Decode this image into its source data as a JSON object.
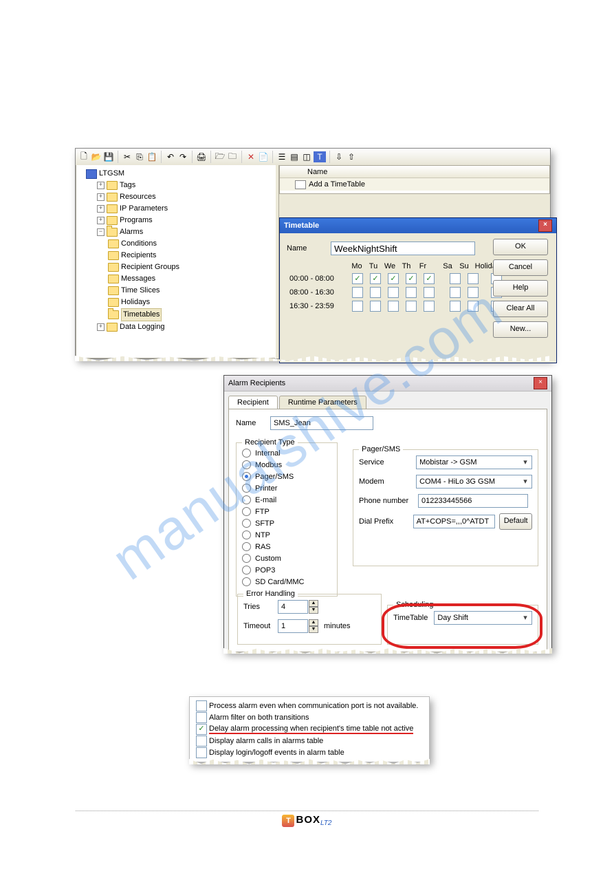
{
  "watermark": "manualshive.com",
  "tree": {
    "root": "LTGSM",
    "items": [
      "Tags",
      "Resources",
      "IP Parameters",
      "Programs",
      "Alarms",
      "Data Logging"
    ],
    "alarms": [
      "Conditions",
      "Recipients",
      "Recipient Groups",
      "Messages",
      "Time Slices",
      "Holidays",
      "Timetables"
    ]
  },
  "list": {
    "header": "Name",
    "add": "Add a TimeTable"
  },
  "timetable": {
    "title": "Timetable",
    "name_label": "Name",
    "name_value": "WeekNightShift",
    "days": [
      "Mo",
      "Tu",
      "We",
      "Th",
      "Fr",
      "Sa",
      "Su",
      "Holiday"
    ],
    "slots": [
      "00:00 - 08:00",
      "08:00 - 16:30",
      "16:30 - 23:59"
    ],
    "grid": [
      [
        true,
        true,
        true,
        true,
        true,
        false,
        false,
        false
      ],
      [
        false,
        false,
        false,
        false,
        false,
        false,
        false,
        false
      ],
      [
        false,
        false,
        false,
        false,
        false,
        false,
        false,
        false
      ]
    ],
    "buttons": [
      "OK",
      "Cancel",
      "Help",
      "Clear All",
      "New..."
    ]
  },
  "recipients": {
    "title": "Alarm Recipients",
    "tabs": [
      "Recipient",
      "Runtime Parameters"
    ],
    "name_label": "Name",
    "name_value": "SMS_Jean",
    "type_legend": "Recipient Type",
    "types": [
      "Internal",
      "Modbus",
      "Pager/SMS",
      "Printer",
      "E-mail",
      "FTP",
      "SFTP",
      "NTP",
      "RAS",
      "Custom",
      "POP3",
      "SD Card/MMC"
    ],
    "type_selected": "Pager/SMS",
    "pager_legend": "Pager/SMS",
    "pager": {
      "service_label": "Service",
      "service_value": "Mobistar -> GSM",
      "modem_label": "Modem",
      "modem_value": "COM4 - HiLo 3G GSM",
      "phone_label": "Phone number",
      "phone_value": "012233445566",
      "dial_label": "Dial Prefix",
      "dial_value": "AT+COPS=,,,0^ATDT",
      "default_btn": "Default"
    },
    "err": {
      "legend": "Error Handling",
      "tries_label": "Tries",
      "tries_value": "4",
      "timeout_label": "Timeout",
      "timeout_value": "1",
      "timeout_unit": "minutes"
    },
    "sched": {
      "legend": "Scheduling",
      "tt_label": "TimeTable",
      "tt_value": "Day Shift"
    }
  },
  "options": [
    "Process alarm even when communication port is not available.",
    "Alarm filter on both transitions",
    "Delay alarm processing when recipient's time table not active",
    "Display alarm calls in alarms table",
    "Display login/logoff events in alarm table"
  ],
  "footer": {
    "brand": "BOX",
    "suffix": "LT2"
  }
}
